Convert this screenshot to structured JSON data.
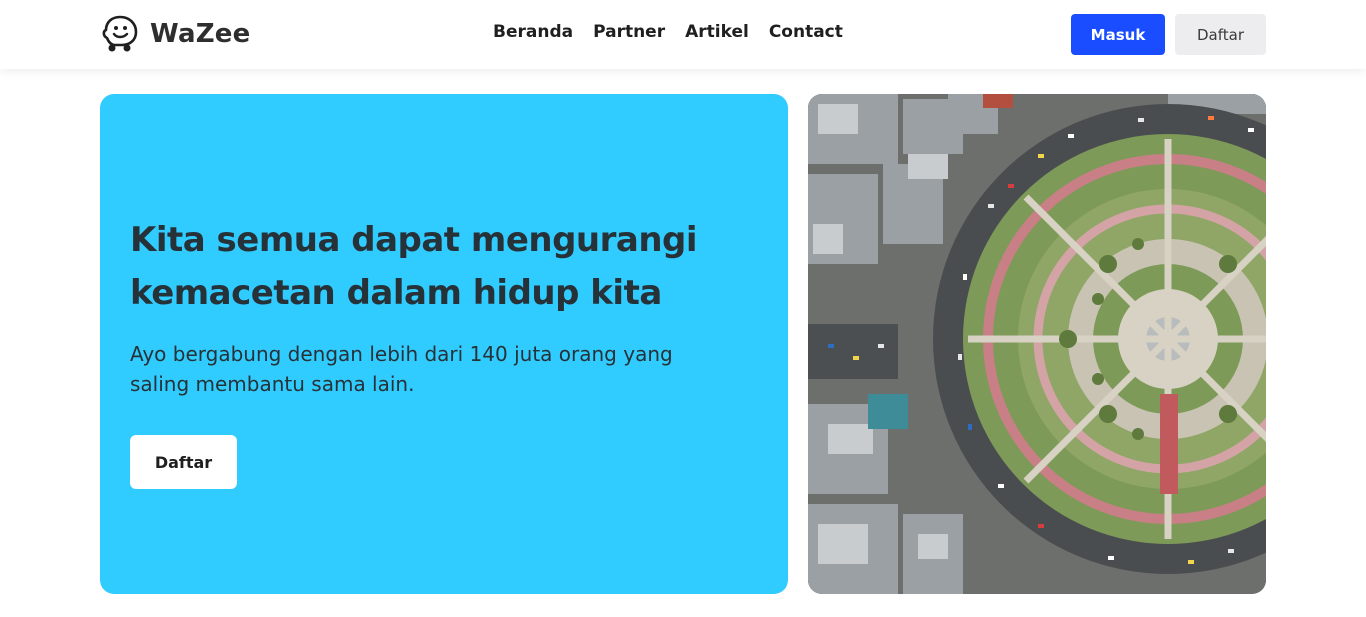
{
  "brand": {
    "name": "WaZee",
    "logo_icon": "waze-smiley-icon"
  },
  "nav": {
    "links": [
      "Beranda",
      "Partner",
      "Artikel",
      "Contact"
    ],
    "login_label": "Masuk",
    "register_label": "Daftar",
    "accent_color": "#1a4dff"
  },
  "hero": {
    "title": "Kita semua dapat mengurangi kemacetan dalam hidup kita",
    "subtitle": "Ayo bergabung dengan lebih dari 140 juta orang yang saling membantu sama lain.",
    "cta_label": "Daftar",
    "card_color": "#31ccff"
  }
}
